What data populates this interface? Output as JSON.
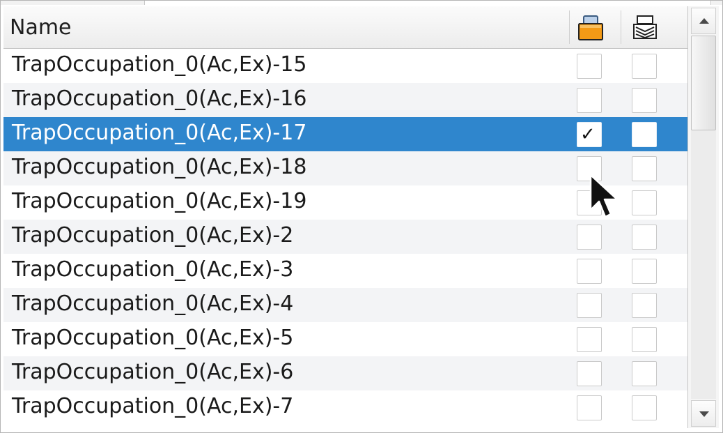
{
  "header": {
    "name_label": "Name",
    "col1_icon": "orange-lock-icon",
    "col2_icon": "stacked-layers-icon"
  },
  "rows": [
    {
      "label": "TrapOccupation_0(Ac,Ex)-15",
      "col1": false,
      "col2": false,
      "selected": false
    },
    {
      "label": "TrapOccupation_0(Ac,Ex)-16",
      "col1": false,
      "col2": false,
      "selected": false
    },
    {
      "label": "TrapOccupation_0(Ac,Ex)-17",
      "col1": true,
      "col2": false,
      "selected": true
    },
    {
      "label": "TrapOccupation_0(Ac,Ex)-18",
      "col1": false,
      "col2": false,
      "selected": false
    },
    {
      "label": "TrapOccupation_0(Ac,Ex)-19",
      "col1": false,
      "col2": false,
      "selected": false
    },
    {
      "label": "TrapOccupation_0(Ac,Ex)-2",
      "col1": false,
      "col2": false,
      "selected": false
    },
    {
      "label": "TrapOccupation_0(Ac,Ex)-3",
      "col1": false,
      "col2": false,
      "selected": false
    },
    {
      "label": "TrapOccupation_0(Ac,Ex)-4",
      "col1": false,
      "col2": false,
      "selected": false
    },
    {
      "label": "TrapOccupation_0(Ac,Ex)-5",
      "col1": false,
      "col2": false,
      "selected": false
    },
    {
      "label": "TrapOccupation_0(Ac,Ex)-6",
      "col1": false,
      "col2": false,
      "selected": false
    },
    {
      "label": "TrapOccupation_0(Ac,Ex)-7",
      "col1": false,
      "col2": false,
      "selected": false
    }
  ],
  "checkmark_glyph": "✓",
  "colors": {
    "selection": "#2f86cd",
    "lock_orange": "#f39a16"
  }
}
